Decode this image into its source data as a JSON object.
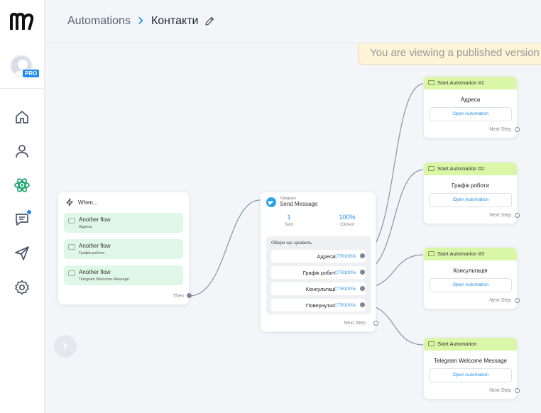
{
  "app": {
    "logo_icon": "manychat-logo"
  },
  "sidebar": {
    "badge": "PRO",
    "items": [
      {
        "name": "home-icon"
      },
      {
        "name": "contacts-icon"
      },
      {
        "name": "automation-icon",
        "active": true
      },
      {
        "name": "chat-icon",
        "notification": true
      },
      {
        "name": "broadcast-icon"
      },
      {
        "name": "settings-icon"
      }
    ]
  },
  "header": {
    "breadcrumb_root": "Automations",
    "separator": ">",
    "title": "Контакти"
  },
  "banner": {
    "text": "You are viewing a published version"
  },
  "when_node": {
    "title": "When...",
    "triggers": [
      {
        "title": "Another flow",
        "subtitle": "Адреса"
      },
      {
        "title": "Another flow",
        "subtitle": "Графік роботи"
      },
      {
        "title": "Another flow",
        "subtitle": "Telegram Welcome Message"
      }
    ],
    "then_label": "Then"
  },
  "telegram_node": {
    "channel": "Telegram",
    "title": "Send Message",
    "stats": [
      {
        "value": "1",
        "label": "Sent"
      },
      {
        "value": "100%",
        "label": "Clicked"
      }
    ],
    "choices_title": "Обери що цікавить",
    "choices": [
      {
        "label": "Адреса",
        "ctr": "CTR100%"
      },
      {
        "label": "Графік робот",
        "ctr": "CTR100%"
      },
      {
        "label": "Консультаці",
        "ctr": "CTR100%"
      },
      {
        "label": "Повернутис",
        "ctr": "CTR100%"
      }
    ],
    "next_step": "Next Step"
  },
  "start_nodes": [
    {
      "title": "Start Automation #1",
      "label": "Адреса",
      "button": "Open Automation",
      "next_step": "Next Step"
    },
    {
      "title": "Start Automation #2",
      "label": "Графік роботи",
      "button": "Open Automation",
      "next_step": "Next Step"
    },
    {
      "title": "Start Automation #3",
      "label": "Консультація",
      "button": "Open Automation",
      "next_step": "Next Step"
    },
    {
      "title": "Start Automation",
      "label": "Telegram Welcome Message",
      "button": "Open Automation",
      "next_step": "Next Step"
    }
  ],
  "colors": {
    "accent": "#1d8cf0",
    "active_nav": "#1aa36b",
    "trigger_bg": "#dff7e6",
    "start_header_bg": "#d9f7a7",
    "banner_bg": "#fdf3d6"
  }
}
